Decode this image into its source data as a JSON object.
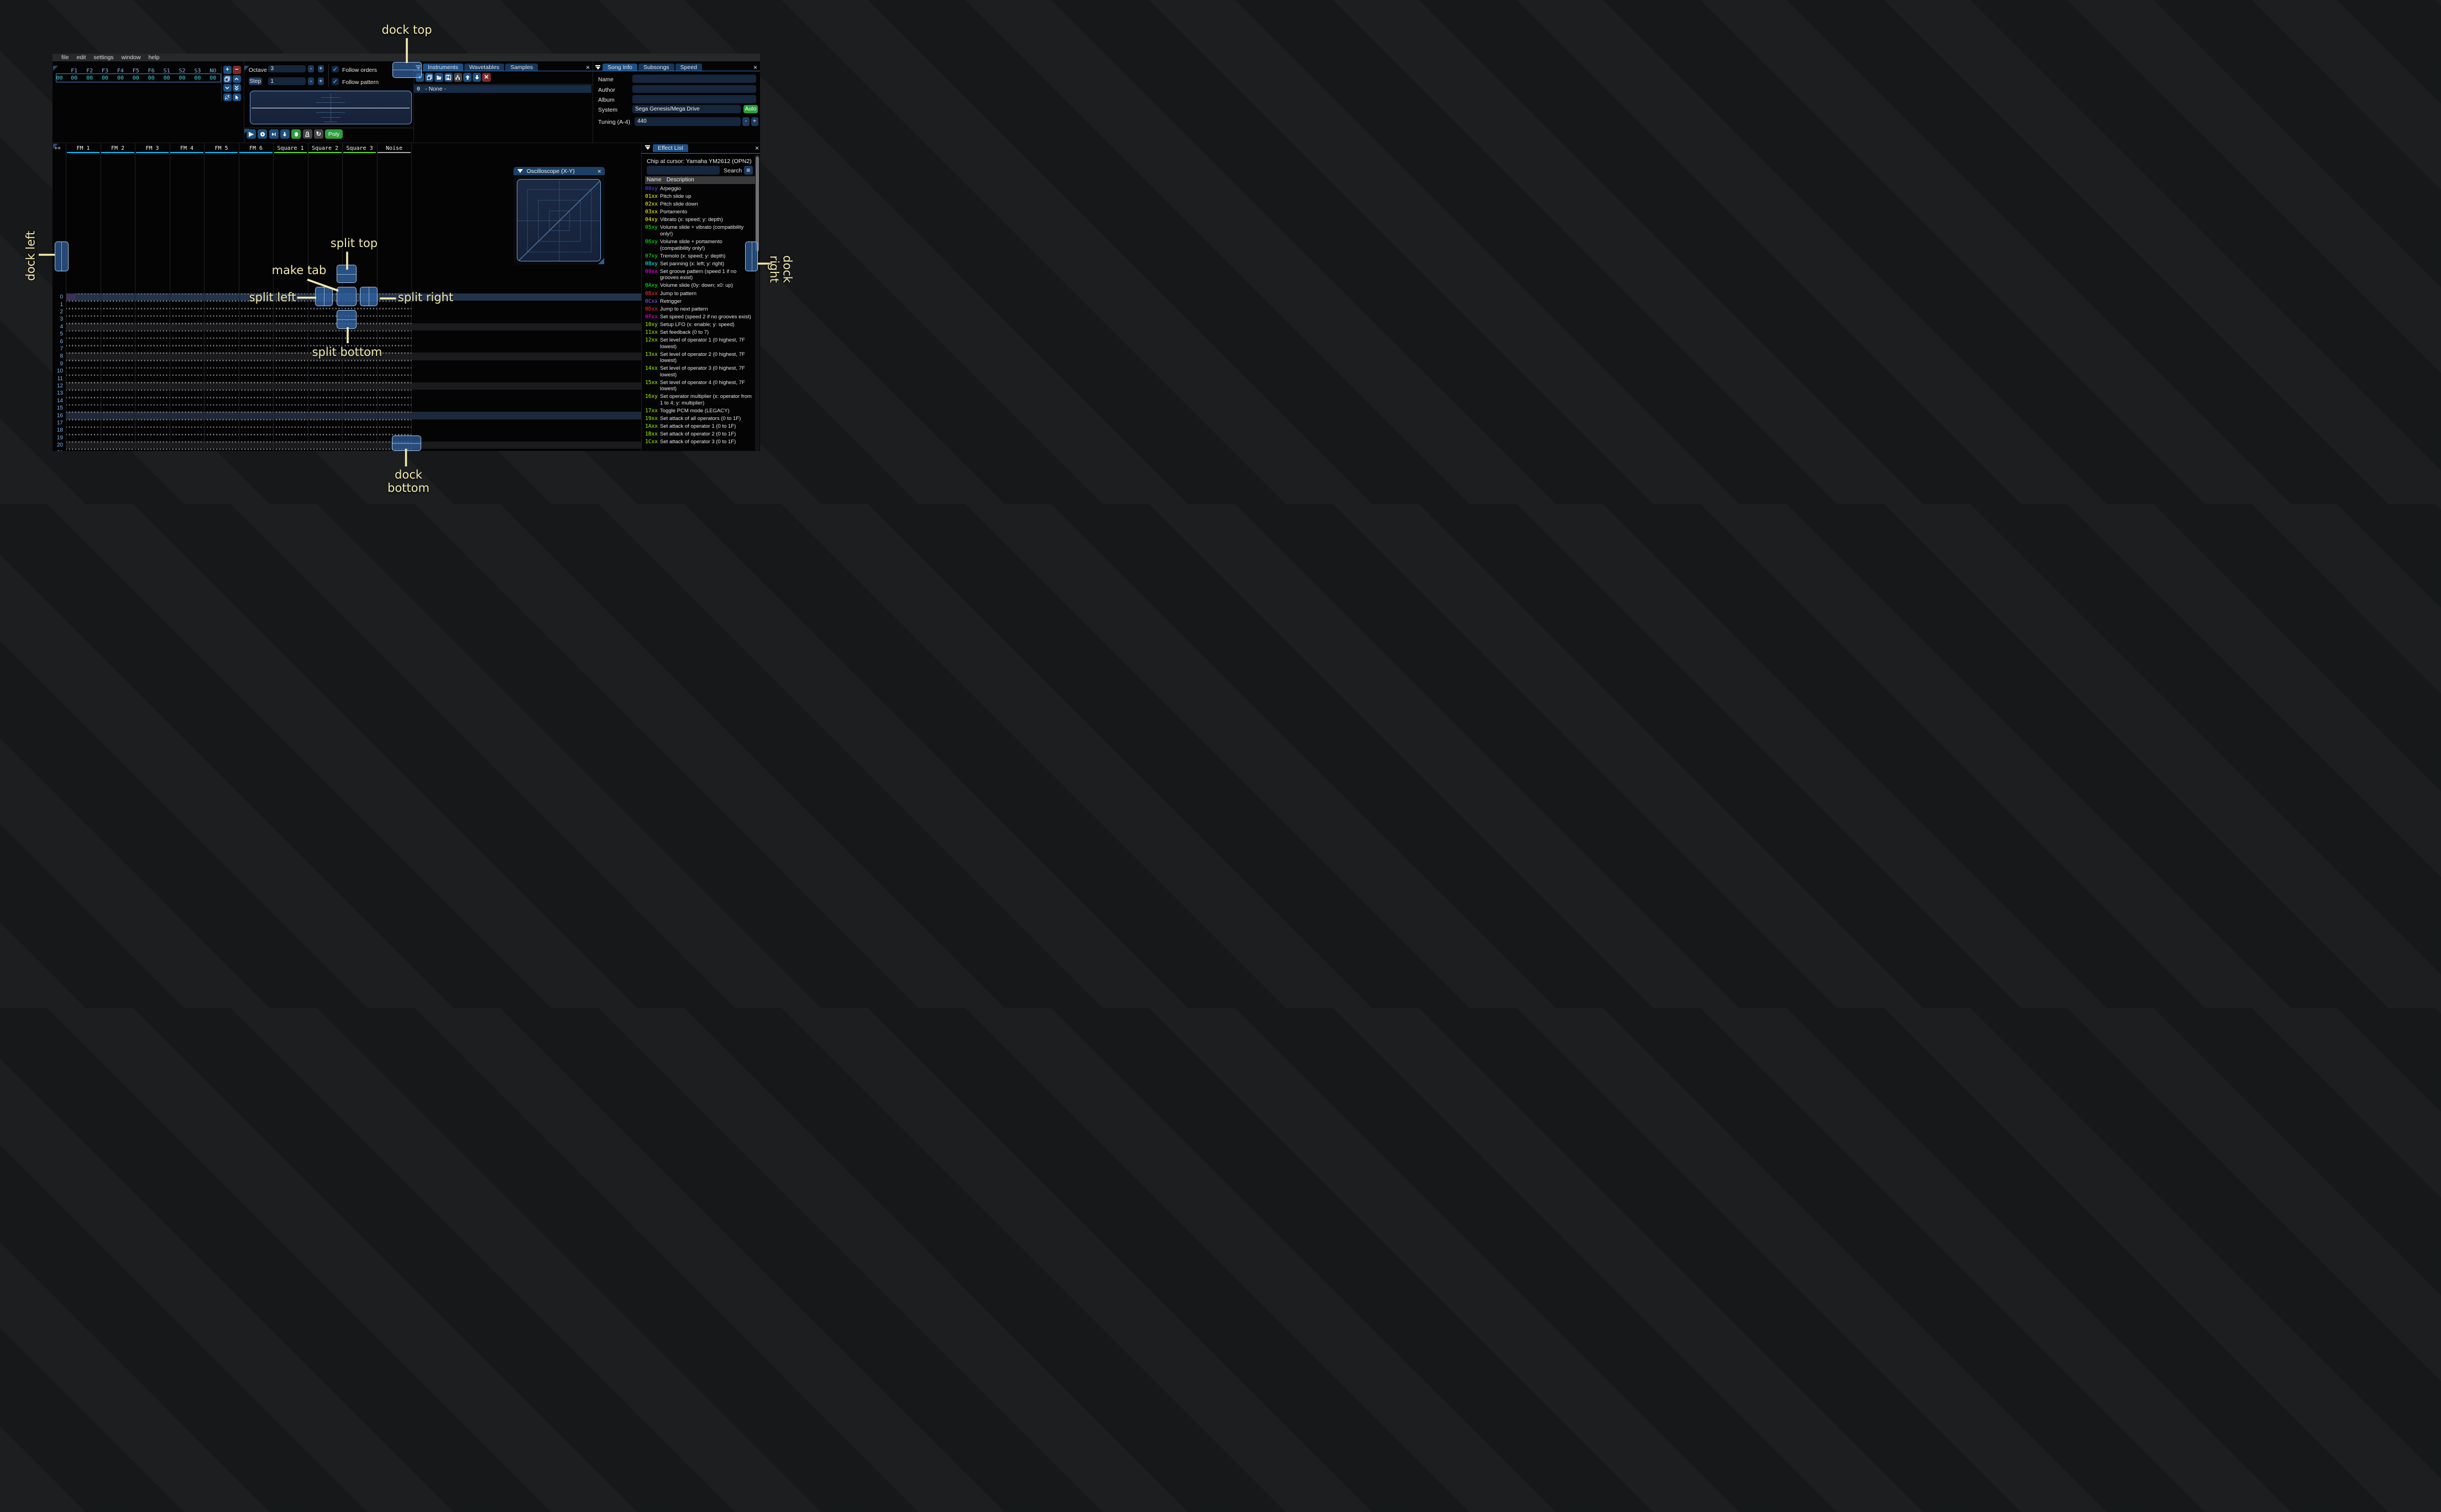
{
  "menu_bar": {
    "items": [
      "file",
      "edit",
      "settings",
      "window",
      "help"
    ]
  },
  "orders_panel": {
    "channel_headers": [
      "F1",
      "F2",
      "F3",
      "F4",
      "F5",
      "F6",
      "S1",
      "S2",
      "S3",
      "NO"
    ],
    "rows": [
      {
        "index": "00",
        "values": [
          "00",
          "00",
          "00",
          "00",
          "00",
          "00",
          "00",
          "00",
          "00",
          "00"
        ]
      }
    ],
    "buttons": [
      "add-order",
      "remove-order",
      "duplicate-order",
      "move-order-up",
      "move-order-down",
      "order-change-all",
      "unlink-order",
      "order-edit-mode"
    ]
  },
  "play_controls": {
    "octave_label": "Octave",
    "octave_value": "3",
    "step_label": "Step",
    "step_value": "1",
    "minus_label": "-",
    "plus_label": "+",
    "follow_orders_label": "Follow orders",
    "follow_orders_checked": true,
    "follow_pattern_label": "Follow pattern",
    "follow_pattern_checked": true,
    "transport_buttons": [
      "play",
      "play-pattern",
      "play-row",
      "step-row",
      "record",
      "metronome",
      "repeat"
    ],
    "poly_label": "Poly"
  },
  "instruments_panel": {
    "tabs": [
      "Instruments",
      "Wavetables",
      "Samples"
    ],
    "active_tab": "Instruments",
    "toolbar": [
      "add",
      "duplicate",
      "open",
      "save",
      "toggle-folders",
      "move-up",
      "move-down",
      "delete"
    ],
    "items": [
      {
        "index": "0",
        "name": "- None -",
        "selected": true
      }
    ]
  },
  "song_info_panel": {
    "tabs": [
      "Song Info",
      "Subsongs",
      "Speed"
    ],
    "active_tab": "Song Info",
    "name_label": "Name",
    "name_value": "",
    "author_label": "Author",
    "author_value": "",
    "album_label": "Album",
    "album_value": "",
    "system_label": "System",
    "system_value": "Sega Genesis/Mega Drive",
    "auto_button": "Auto",
    "auto_color": "#2f9e41",
    "tuning_label": "Tuning (A-4)",
    "tuning_value": "440"
  },
  "pattern_panel": {
    "expand_button": "++",
    "channels": [
      {
        "label": "FM 1",
        "color": "#00c3ff"
      },
      {
        "label": "FM 2",
        "color": "#00c3ff"
      },
      {
        "label": "FM 3",
        "color": "#00c3ff"
      },
      {
        "label": "FM 4",
        "color": "#00c3ff"
      },
      {
        "label": "FM 5",
        "color": "#00c3ff"
      },
      {
        "label": "FM 6",
        "color": "#00c3ff"
      },
      {
        "label": "Square 1",
        "color": "#52e512"
      },
      {
        "label": "Square 2",
        "color": "#52e512"
      },
      {
        "label": "Square 3",
        "color": "#52e512"
      },
      {
        "label": "Noise",
        "color": "#a9a9a9"
      }
    ],
    "row_count": 22,
    "cursor_row": 0,
    "colors": {
      "cursor_row_bg": "#243349",
      "cursor_cell_bg": "#3b3156",
      "highlight16_bg": "#1d2938",
      "highlight4_bg": "#1b1b1d"
    }
  },
  "effect_list_panel": {
    "tab": "Effect List",
    "chip_at_cursor": "Chip at cursor: Yamaha YM2612 (OPN2)",
    "search_value": "",
    "search_label": "Search",
    "columns": {
      "name": "Name",
      "description": "Description"
    },
    "effects": [
      {
        "code": "00xy",
        "color": "#4848ff",
        "desc": "Arpeggio"
      },
      {
        "code": "01xx",
        "color": "#ffff00",
        "desc": "Pitch slide up"
      },
      {
        "code": "02xx",
        "color": "#ffff00",
        "desc": "Pitch slide down"
      },
      {
        "code": "03xx",
        "color": "#ffff00",
        "desc": "Portamento"
      },
      {
        "code": "04xy",
        "color": "#ffff00",
        "desc": "Vibrato (x: speed; y: depth)"
      },
      {
        "code": "05xy",
        "color": "#00ff00",
        "desc": "Volume slide + vibrato (compatibility only!)"
      },
      {
        "code": "06xy",
        "color": "#00ff00",
        "desc": "Volume slide + portamento (compatibility only!)"
      },
      {
        "code": "07xy",
        "color": "#00ff00",
        "desc": "Tremolo (x: speed; y: depth)"
      },
      {
        "code": "08xy",
        "color": "#00ffff",
        "desc": "Set panning (x: left; y: right)"
      },
      {
        "code": "09xx",
        "color": "#ff00ff",
        "desc": "Set groove pattern (speed 1 if no grooves exist)"
      },
      {
        "code": "0Axy",
        "color": "#00ff00",
        "desc": "Volume slide (0y: down; x0: up)"
      },
      {
        "code": "0Bxx",
        "color": "#ff3030",
        "desc": "Jump to pattern"
      },
      {
        "code": "0Cxx",
        "color": "#8066ff",
        "desc": "Retrigger"
      },
      {
        "code": "0Dxx",
        "color": "#ff3030",
        "desc": "Jump to next pattern"
      },
      {
        "code": "0Fxx",
        "color": "#ff00ff",
        "desc": "Set speed (speed 2 if no grooves exist)"
      },
      {
        "code": "10xy",
        "color": "#9dff00",
        "desc": "Setup LFO (x: enable; y: speed)"
      },
      {
        "code": "11xx",
        "color": "#9dff00",
        "desc": "Set feedback (0 to 7)"
      },
      {
        "code": "12xx",
        "color": "#9dff00",
        "desc": "Set level of operator 1 (0 highest, 7F lowest)"
      },
      {
        "code": "13xx",
        "color": "#9dff00",
        "desc": "Set level of operator 2 (0 highest, 7F lowest)"
      },
      {
        "code": "14xx",
        "color": "#9dff00",
        "desc": "Set level of operator 3 (0 highest, 7F lowest)"
      },
      {
        "code": "15xx",
        "color": "#9dff00",
        "desc": "Set level of operator 4 (0 highest, 7F lowest)"
      },
      {
        "code": "16xy",
        "color": "#9dff00",
        "desc": "Set operator multiplier (x: operator from 1 to 4; y: multiplier)"
      },
      {
        "code": "17xx",
        "color": "#9dff00",
        "desc": "Toggle PCM mode (LEGACY)"
      },
      {
        "code": "19xx",
        "color": "#9dff00",
        "desc": "Set attack of all operators (0 to 1F)"
      },
      {
        "code": "1Axx",
        "color": "#9dff00",
        "desc": "Set attack of operator 1 (0 to 1F)"
      },
      {
        "code": "1Bxx",
        "color": "#9dff00",
        "desc": "Set attack of operator 2 (0 to 1F)"
      },
      {
        "code": "1Cxx",
        "color": "#9dff00",
        "desc": "Set attack of operator 3 (0 to 1F)"
      }
    ]
  },
  "oscilloscope_window": {
    "title": "Oscilloscope (X-Y)"
  },
  "dock_overlay": {
    "labels": {
      "dock_top": "dock top",
      "dock_bottom": "dock bottom",
      "dock_left": "dock left",
      "dock_right": "dock right",
      "split_top": "split top",
      "split_bottom": "split bottom",
      "split_left": "split left",
      "split_right": "split right",
      "make_tab": "make tab"
    },
    "accent_color": "#f2e9ac"
  }
}
